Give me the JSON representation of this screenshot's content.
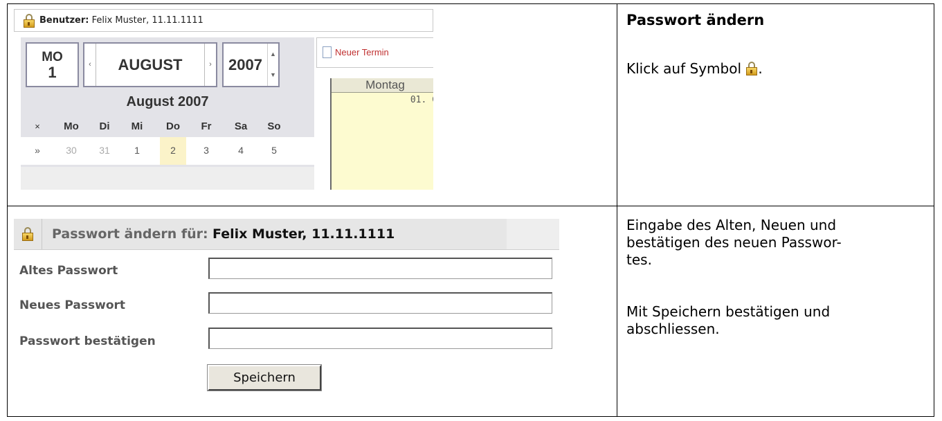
{
  "top_section": {
    "title": "Passwort ändern",
    "instruction": "Klick auf Symbol",
    "instruction_end": ".",
    "app_screenshot": {
      "user_label": "Benutzer:",
      "user_name": "Felix Muster, 11.11.1111",
      "calendar": {
        "day_of_week": "MO",
        "day_number": "1",
        "month": "AUGUST",
        "year": "2007",
        "month_title": "August 2007",
        "weekdays": [
          "×",
          "Mo",
          "Di",
          "Mi",
          "Do",
          "Fr",
          "Sa",
          "So"
        ],
        "week_row": [
          "»",
          "30",
          "31",
          "1",
          "2",
          "3",
          "4",
          "5"
        ]
      },
      "new_appointment": "Neuer Termin",
      "day_header": "Montag",
      "day_date": "01. C"
    }
  },
  "bottom_section": {
    "instruction_1": "Eingabe des Alten, Neuen und bestätigen des neuen Passwor-tes.",
    "instruction_1_lines": [
      "Eingabe des Alten, Neuen und",
      "bestätigen des neuen Passwor-",
      "tes."
    ],
    "instruction_2_lines": [
      "Mit Speichern bestätigen und",
      "abschliessen."
    ],
    "form": {
      "header_label": "Passwort ändern für:",
      "header_user": "Felix Muster, 11.11.1111",
      "fields": [
        {
          "label": "Altes Passwort",
          "value": ""
        },
        {
          "label": "Neues Passwort",
          "value": ""
        },
        {
          "label": "Passwort bestätigen",
          "value": ""
        }
      ],
      "save_label": "Speichern"
    }
  }
}
